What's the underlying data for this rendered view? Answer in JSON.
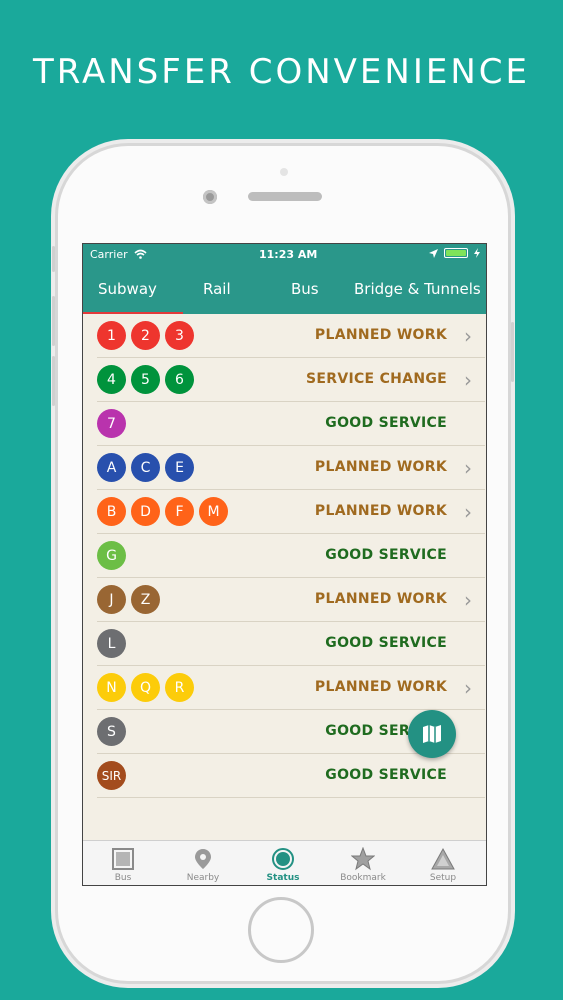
{
  "headline": "TRANSFER CONVENIENCE",
  "status_bar": {
    "carrier": "Carrier",
    "time": "11:23 AM"
  },
  "top_tabs": [
    {
      "label": "Subway",
      "active": true
    },
    {
      "label": "Rail"
    },
    {
      "label": "Bus"
    },
    {
      "label": "Bridge & Tunnels"
    }
  ],
  "lines": [
    {
      "routes": [
        "1",
        "2",
        "3"
      ],
      "color": "#ee352e",
      "status": "PLANNED WORK",
      "kind": "planned",
      "chevron": true
    },
    {
      "routes": [
        "4",
        "5",
        "6"
      ],
      "color": "#00933c",
      "status": "SERVICE CHANGE",
      "kind": "change",
      "chevron": true
    },
    {
      "routes": [
        "7"
      ],
      "color": "#b933ad",
      "status": "GOOD SERVICE",
      "kind": "good",
      "chevron": false
    },
    {
      "routes": [
        "A",
        "C",
        "E"
      ],
      "color": "#2850ad",
      "status": "PLANNED WORK",
      "kind": "planned",
      "chevron": true
    },
    {
      "routes": [
        "B",
        "D",
        "F",
        "M"
      ],
      "color": "#ff6319",
      "status": "PLANNED WORK",
      "kind": "planned",
      "chevron": true
    },
    {
      "routes": [
        "G"
      ],
      "color": "#6cbe45",
      "status": "GOOD SERVICE",
      "kind": "good",
      "chevron": false
    },
    {
      "routes": [
        "J",
        "Z"
      ],
      "color": "#996633",
      "status": "PLANNED WORK",
      "kind": "planned",
      "chevron": true
    },
    {
      "routes": [
        "L"
      ],
      "color": "#6d6e71",
      "status": "GOOD SERVICE",
      "kind": "good",
      "chevron": false
    },
    {
      "routes": [
        "N",
        "Q",
        "R"
      ],
      "color": "#fccc0a",
      "status": "PLANNED WORK",
      "kind": "planned",
      "chevron": true
    },
    {
      "routes": [
        "S"
      ],
      "color": "#6d6e71",
      "status": "GOOD SERVICE",
      "kind": "good",
      "chevron": false
    },
    {
      "routes": [
        "SIR"
      ],
      "color": "#a34c1d",
      "status": "GOOD SERVICE",
      "kind": "good",
      "chevron": false
    }
  ],
  "tab_bar": [
    {
      "label": "Bus",
      "icon": "bus-square-icon"
    },
    {
      "label": "Nearby",
      "icon": "location-pin-icon"
    },
    {
      "label": "Status",
      "icon": "status-circle-icon",
      "active": true
    },
    {
      "label": "Bookmark",
      "icon": "star-icon"
    },
    {
      "label": "Setup",
      "icon": "triangle-icon"
    }
  ],
  "colors": {
    "background": "#1aa99b",
    "header": "#2a978a",
    "accent": "#239183"
  }
}
